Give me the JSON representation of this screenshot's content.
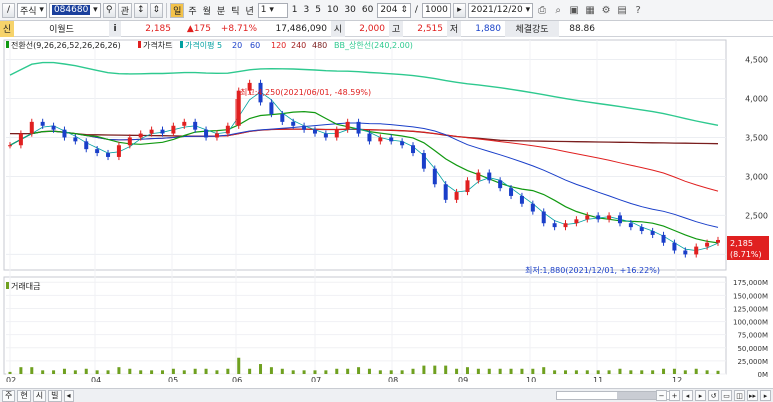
{
  "toolbar": {
    "market_select": "주식",
    "stock_code": "084680",
    "search_icon": "search-icon",
    "relation_label": "관",
    "updown_label": "↑↓",
    "period_buttons": [
      "주",
      "월",
      "분",
      "틱",
      "년"
    ],
    "interval_value": "1",
    "minute_buttons": [
      "1",
      "3",
      "5",
      "10",
      "30",
      "60"
    ],
    "count_value": "204",
    "count_total": "1000",
    "date_value": "2021/12/20"
  },
  "info": {
    "category_badge": "신",
    "stock_name": "이월드",
    "info_icon": "i",
    "price": "2,185",
    "change": "▲175",
    "change_pct": "+8.71%",
    "volume": "17,486,090",
    "open_label": "시",
    "open_value": "2,000",
    "high_label": "고",
    "high_value": "2,515",
    "low_label": "저",
    "low_value": "1,880",
    "strength_label": "체결강도",
    "strength_value": "88.86"
  },
  "legend": {
    "ichimoku": "전환선(9,26,26,52,26,26,26)",
    "price_chart": "가격차트",
    "ma_label": "가격이평 5",
    "ma_values": [
      "20",
      "60",
      "120",
      "240",
      "480"
    ],
    "bb": "BB_상한선(240,2.00)",
    "volume_panel": "거래대금"
  },
  "annotations": {
    "high": "최고:4,250(2021/06/01, -48.59%)",
    "low": "최저:1,880(2021/12/01, +16.22%)",
    "last_price": "2,185",
    "last_pct": "(8.71%)"
  },
  "colors": {
    "up_candle": "#e02020",
    "down_candle": "#1a3fc9",
    "ma5": "#00a0a0",
    "ma20": "#1a3fc9",
    "ma60": "#1a3fc9",
    "ma120": "#e02020",
    "ma240": "#a02020",
    "ma480": "#7a1e1e",
    "bb_upper": "#2ec98f",
    "conversion_line": "#119911",
    "volume_bar": "#6fa020"
  },
  "chart_data": [
    {
      "type": "line",
      "title": "",
      "x_ticks": [
        "02",
        "04",
        "05",
        "06",
        "07",
        "08",
        "09",
        "10",
        "11",
        "12"
      ],
      "y_ticks": [
        "4,500",
        "4,000",
        "3,500",
        "3,000",
        "2,500",
        "2,000"
      ],
      "ylim": [
        1800,
        4750
      ],
      "grid": true,
      "series": [
        {
          "name": "가격차트",
          "values": [
            3400,
            3550,
            3700,
            3650,
            3600,
            3500,
            3450,
            3350,
            3300,
            3250,
            3400,
            3500,
            3550,
            3600,
            3550,
            3650,
            3700,
            3600,
            3500,
            3550,
            3650,
            4100,
            4200,
            3950,
            3800,
            3700,
            3650,
            3600,
            3550,
            3500,
            3600,
            3700,
            3550,
            3450,
            3500,
            3450,
            3400,
            3300,
            3100,
            2900,
            2700,
            2800,
            2950,
            3050,
            2950,
            2850,
            2750,
            2650,
            2550,
            2400,
            2350,
            2400,
            2450,
            2500,
            2450,
            2500,
            2400,
            2350,
            2300,
            2250,
            2150,
            2050,
            2000,
            2100,
            2150,
            2185
          ]
        }
      ]
    },
    {
      "type": "bar",
      "title": "거래대금",
      "y_ticks": [
        "175,000M",
        "150,000M",
        "125,000M",
        "100,000M",
        "75,000M",
        "50,000M",
        "25,000M",
        "0M"
      ],
      "ylim": [
        0,
        185000
      ]
    }
  ]
}
